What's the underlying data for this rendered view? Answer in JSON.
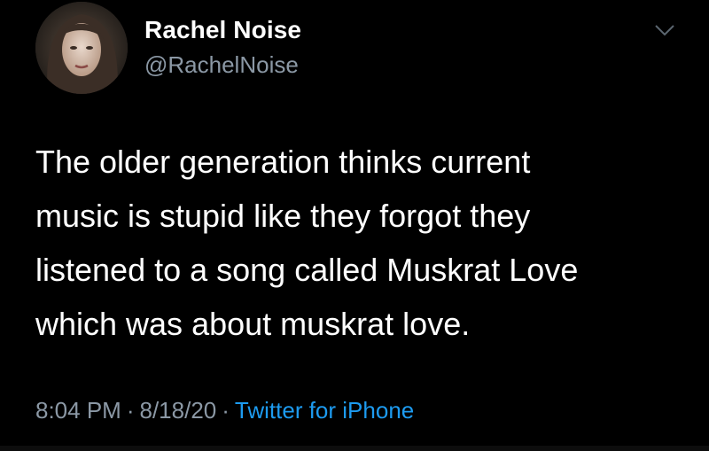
{
  "tweet": {
    "display_name": "Rachel Noise",
    "handle": "@RachelNoise",
    "lines": [
      "The older generation thinks current",
      "music is stupid like they forgot they",
      "listened to a song called Muskrat Love",
      "which was about muskrat love."
    ],
    "time": "8:04 PM",
    "date": "8/18/20",
    "source": "Twitter for iPhone",
    "separator": "·"
  },
  "icons": {
    "menu": "chevron-down-icon",
    "avatar": "profile-photo"
  },
  "colors": {
    "background": "#000000",
    "text": "#ffffff",
    "secondary": "#8b98a5",
    "link": "#1d9bf0"
  }
}
